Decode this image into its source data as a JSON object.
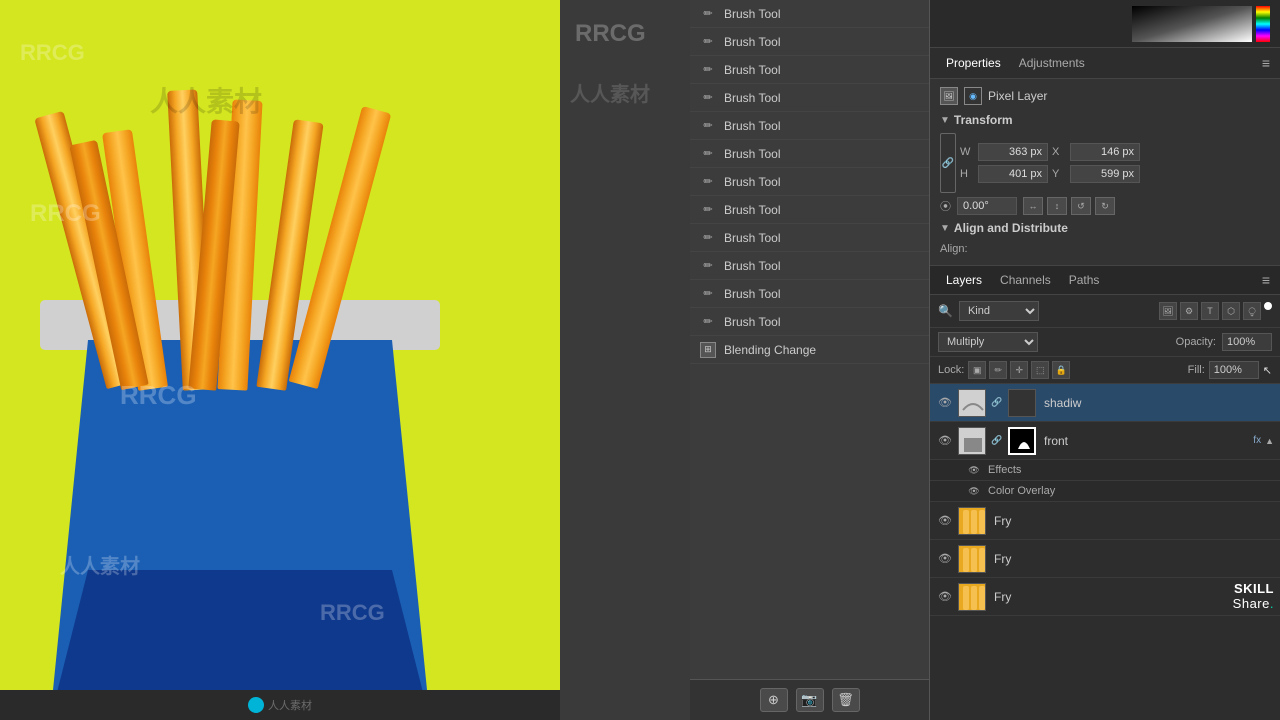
{
  "canvas": {
    "watermarks": [
      "RRCG",
      "人人素材",
      "RRCG",
      "人人素材",
      "RRCG",
      "人人素材"
    ],
    "bottom_logo": "人人素材"
  },
  "context_menu": {
    "items": [
      {
        "id": 1,
        "label": "Brush Tool",
        "icon": "brush"
      },
      {
        "id": 2,
        "label": "Brush Tool",
        "icon": "brush"
      },
      {
        "id": 3,
        "label": "Brush Tool",
        "icon": "brush"
      },
      {
        "id": 4,
        "label": "Brush Tool",
        "icon": "brush"
      },
      {
        "id": 5,
        "label": "Brush Tool",
        "icon": "brush"
      },
      {
        "id": 6,
        "label": "Brush Tool",
        "icon": "brush"
      },
      {
        "id": 7,
        "label": "Brush Tool",
        "icon": "brush"
      },
      {
        "id": 8,
        "label": "Brush Tool",
        "icon": "brush"
      },
      {
        "id": 9,
        "label": "Brush Tool",
        "icon": "brush"
      },
      {
        "id": 10,
        "label": "Brush Tool",
        "icon": "brush"
      },
      {
        "id": 11,
        "label": "Brush Tool",
        "icon": "brush"
      },
      {
        "id": 12,
        "label": "Brush Tool",
        "icon": "brush"
      }
    ],
    "blending_item": {
      "label": "Blending Change",
      "icon": "grid"
    },
    "toolbar_buttons": [
      "camera-add",
      "camera",
      "trash"
    ]
  },
  "properties": {
    "tab_properties": "Properties",
    "tab_adjustments": "Adjustments",
    "pixel_layer_label": "Pixel Layer",
    "transform_section": "Transform",
    "w_label": "W",
    "h_label": "H",
    "x_label": "X",
    "y_label": "Y",
    "w_value": "363 px",
    "h_value": "401 px",
    "x_value": "146 px",
    "y_value": "599 px",
    "rotation_value": "0.00°",
    "align_section": "Align and Distribute",
    "align_label": "Align:"
  },
  "layers": {
    "tab_layers": "Layers",
    "tab_channels": "Channels",
    "tab_paths": "Paths",
    "kind_label": "Kind",
    "blend_mode": "Multiply",
    "opacity_label": "Opacity:",
    "opacity_value": "100%",
    "lock_label": "Lock:",
    "fill_label": "Fill:",
    "fill_value": "100%",
    "items": [
      {
        "id": "shadow",
        "name": "shadiw",
        "type": "pixel",
        "visible": true,
        "has_mask": true,
        "fx": false
      },
      {
        "id": "front",
        "name": "front",
        "type": "pixel",
        "visible": true,
        "has_mask": true,
        "fx": true,
        "effects": [
          "Effects",
          "Color Overlay"
        ]
      },
      {
        "id": "fry1",
        "name": "Fry",
        "type": "pixel",
        "visible": true,
        "fx": false
      },
      {
        "id": "fry2",
        "name": "Fry",
        "type": "pixel",
        "visible": true,
        "fx": false
      },
      {
        "id": "fry3",
        "name": "Fry",
        "type": "pixel",
        "visible": true,
        "fx": false
      }
    ]
  },
  "skillshare": {
    "skill": "SKILL",
    "share": "Share.",
    "dot": "•"
  }
}
